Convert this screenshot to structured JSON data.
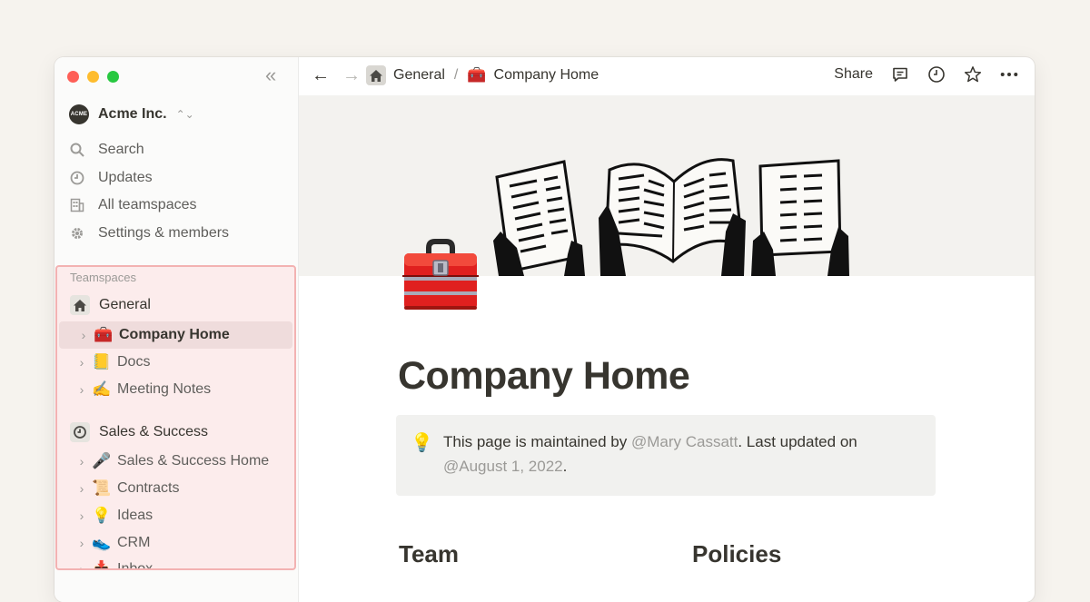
{
  "colors": {
    "traffic_red": "#fe5f57",
    "traffic_yellow": "#febc2e",
    "traffic_green": "#28c840",
    "highlight_border": "#f3b2b2",
    "highlight_bg": "#fcecec"
  },
  "sidebar": {
    "collapse_icon": "double-chevron-left",
    "workspace": {
      "logo": "ACME",
      "name": "Acme Inc.",
      "switch_icon": "up-down-chevron"
    },
    "nav": [
      {
        "label": "Search",
        "icon": "search-icon"
      },
      {
        "label": "Updates",
        "icon": "clock-icon"
      },
      {
        "label": "All teamspaces",
        "icon": "building-icon"
      },
      {
        "label": "Settings & members",
        "icon": "gear-icon"
      }
    ],
    "teamspaces_header": "Teamspaces",
    "teams": [
      {
        "name": "General",
        "icon": "house-icon",
        "pages": [
          {
            "emoji": "🧰",
            "label": "Company Home",
            "active": true
          },
          {
            "emoji": "📒",
            "label": "Docs"
          },
          {
            "emoji": "✍️",
            "label": "Meeting Notes"
          }
        ]
      },
      {
        "name": "Sales & Success",
        "icon": "history-icon",
        "pages": [
          {
            "emoji": "🎤",
            "label": "Sales & Success Home"
          },
          {
            "emoji": "📜",
            "label": "Contracts"
          },
          {
            "emoji": "💡",
            "label": "Ideas"
          },
          {
            "emoji": "👟",
            "label": "CRM"
          },
          {
            "emoji": "📥",
            "label": "Inbox"
          }
        ]
      }
    ]
  },
  "topbar": {
    "breadcrumb": [
      {
        "label": "General",
        "icon": "house-icon"
      },
      {
        "label": "Company Home",
        "icon": "🧰"
      }
    ],
    "separator": "/",
    "share_label": "Share",
    "icons": [
      "comment-icon",
      "clock-icon",
      "star-icon",
      "more-icon"
    ]
  },
  "page": {
    "icon": "toolbox-icon",
    "title": "Company Home",
    "callout": {
      "icon": "💡",
      "text_before": "This page is maintained by ",
      "mention_person": "@Mary Cassatt",
      "text_middle": ". Last updated on ",
      "mention_date": "@August 1, 2022",
      "text_after": "."
    },
    "headings": [
      "Team",
      "Policies"
    ]
  }
}
